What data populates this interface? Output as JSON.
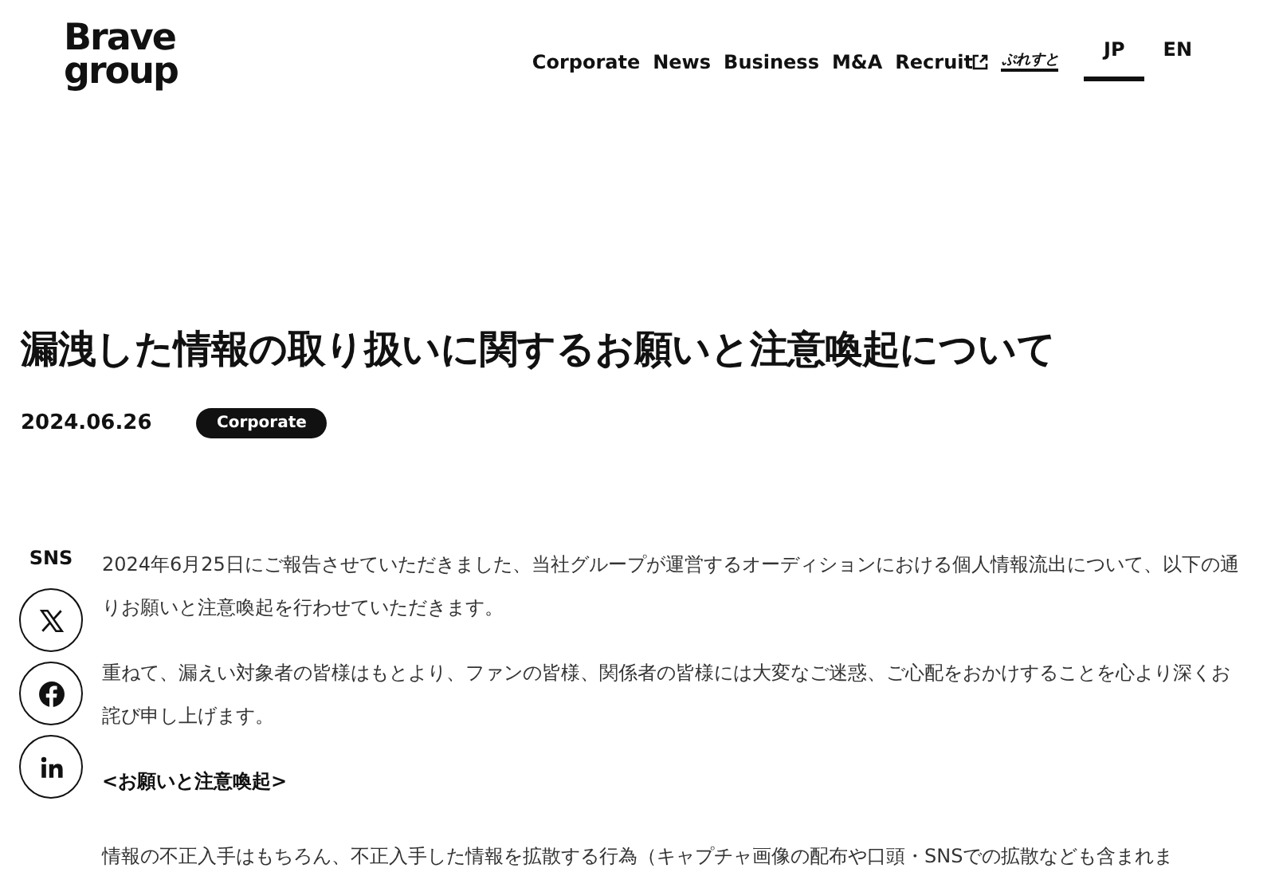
{
  "logo": {
    "line1": "Brave",
    "line2": "group"
  },
  "nav": [
    {
      "label": "Corporate",
      "kind": "text"
    },
    {
      "label": "News",
      "kind": "text"
    },
    {
      "label": "Business",
      "kind": "text"
    },
    {
      "label": "M&A",
      "kind": "text"
    },
    {
      "label": "Recruit",
      "kind": "external"
    },
    {
      "label": "ぷれすと",
      "kind": "logo"
    }
  ],
  "languages": [
    {
      "label": "JP",
      "selected": true
    },
    {
      "label": "EN",
      "selected": false
    }
  ],
  "article": {
    "title": "漏洩した情報の取り扱いに関するお願いと注意喚起について",
    "date": "2024.06.26",
    "category": "Corporate",
    "blocks": [
      {
        "kind": "paragraph",
        "text": "2024年6月25日にご報告させていただきました、当社グループが運営するオーディションにおける個人情報流出について、以下の通りお願いと注意喚起を行わせていただきます。"
      },
      {
        "kind": "paragraph",
        "text": "重ねて、漏えい対象者の皆様はもとより、ファンの皆様、関係者の皆様には大変なご迷惑、ご心配をおかけすることを心より深くお詫び申し上げます。"
      },
      {
        "kind": "heading",
        "text": "<お願いと注意喚起>"
      },
      {
        "kind": "paragraph",
        "text": "情報の不正入手はもちろん、不正入手した情報を拡散する行為（キャプチャ画像の配布や口頭・SNSでの拡散なども含まれま"
      }
    ]
  },
  "sns": {
    "label": "SNS",
    "links": [
      {
        "kind": "x"
      },
      {
        "kind": "facebook"
      },
      {
        "kind": "linkedin"
      }
    ]
  }
}
